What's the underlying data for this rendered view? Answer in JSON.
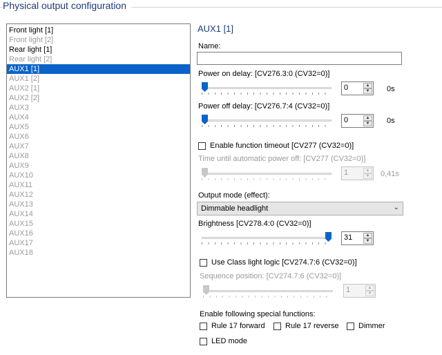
{
  "group": {
    "title": "Physical output configuration"
  },
  "outputs": [
    {
      "label": "Front light [1]",
      "state": "active"
    },
    {
      "label": "Front light [2]",
      "state": "inactive"
    },
    {
      "label": "Rear light [1]",
      "state": "active"
    },
    {
      "label": "Rear light [2]",
      "state": "inactive"
    },
    {
      "label": "AUX1 [1]",
      "state": "selected"
    },
    {
      "label": "AUX1 [2]",
      "state": "inactive"
    },
    {
      "label": "AUX2 [1]",
      "state": "inactive"
    },
    {
      "label": "AUX2 [2]",
      "state": "inactive"
    },
    {
      "label": "AUX3",
      "state": "inactive"
    },
    {
      "label": "AUX4",
      "state": "inactive"
    },
    {
      "label": "AUX5",
      "state": "inactive"
    },
    {
      "label": "AUX6",
      "state": "inactive"
    },
    {
      "label": "AUX7",
      "state": "inactive"
    },
    {
      "label": "AUX8",
      "state": "inactive"
    },
    {
      "label": "AUX9",
      "state": "inactive"
    },
    {
      "label": "AUX10",
      "state": "inactive"
    },
    {
      "label": "AUX11",
      "state": "inactive"
    },
    {
      "label": "AUX12",
      "state": "inactive"
    },
    {
      "label": "AUX13",
      "state": "inactive"
    },
    {
      "label": "AUX14",
      "state": "inactive"
    },
    {
      "label": "AUX15",
      "state": "inactive"
    },
    {
      "label": "AUX16",
      "state": "inactive"
    },
    {
      "label": "AUX17",
      "state": "inactive"
    },
    {
      "label": "AUX18",
      "state": "inactive"
    }
  ],
  "detail": {
    "title": "AUX1 [1]",
    "name_label": "Name:",
    "name_value": "",
    "power_on": {
      "label": "Power on delay: [CV276.3:0 (CV32=0)]",
      "value": "0",
      "unit": "0s",
      "level": 0
    },
    "power_off": {
      "label": "Power off delay: [CV276.7:4 (CV32=0)]",
      "value": "0",
      "unit": "0s",
      "level": 0
    },
    "timeout_checkbox": "Enable function timeout [CV277 (CV32=0)]",
    "timeout": {
      "label": "Time until automatic power off: [CV277 (CV32=0)]",
      "value": "1",
      "unit": "0,41s",
      "level": 0
    },
    "mode_label": "Output mode (effect):",
    "mode_value": "Dimmable headlight",
    "brightness": {
      "label": "Brightness [CV278.4:0 (CV32=0)]",
      "value": "31",
      "level": 1.0
    },
    "class_light_checkbox": "Use Class light logic [CV274.7:6 (CV32=0)]",
    "sequence": {
      "label": "Sequence position: [CV274.7:6 (CV32=0)]",
      "value": "1",
      "level": 0
    },
    "special_label": "Enable following special functions:",
    "special": {
      "rule17_forward": "Rule 17 forward",
      "rule17_reverse": "Rule 17 reverse",
      "dimmer": "Dimmer",
      "led_mode": "LED mode"
    }
  },
  "colors": {
    "accent": "#0a64c8",
    "title": "#1e3a78",
    "disabled": "#9a9a9a"
  }
}
